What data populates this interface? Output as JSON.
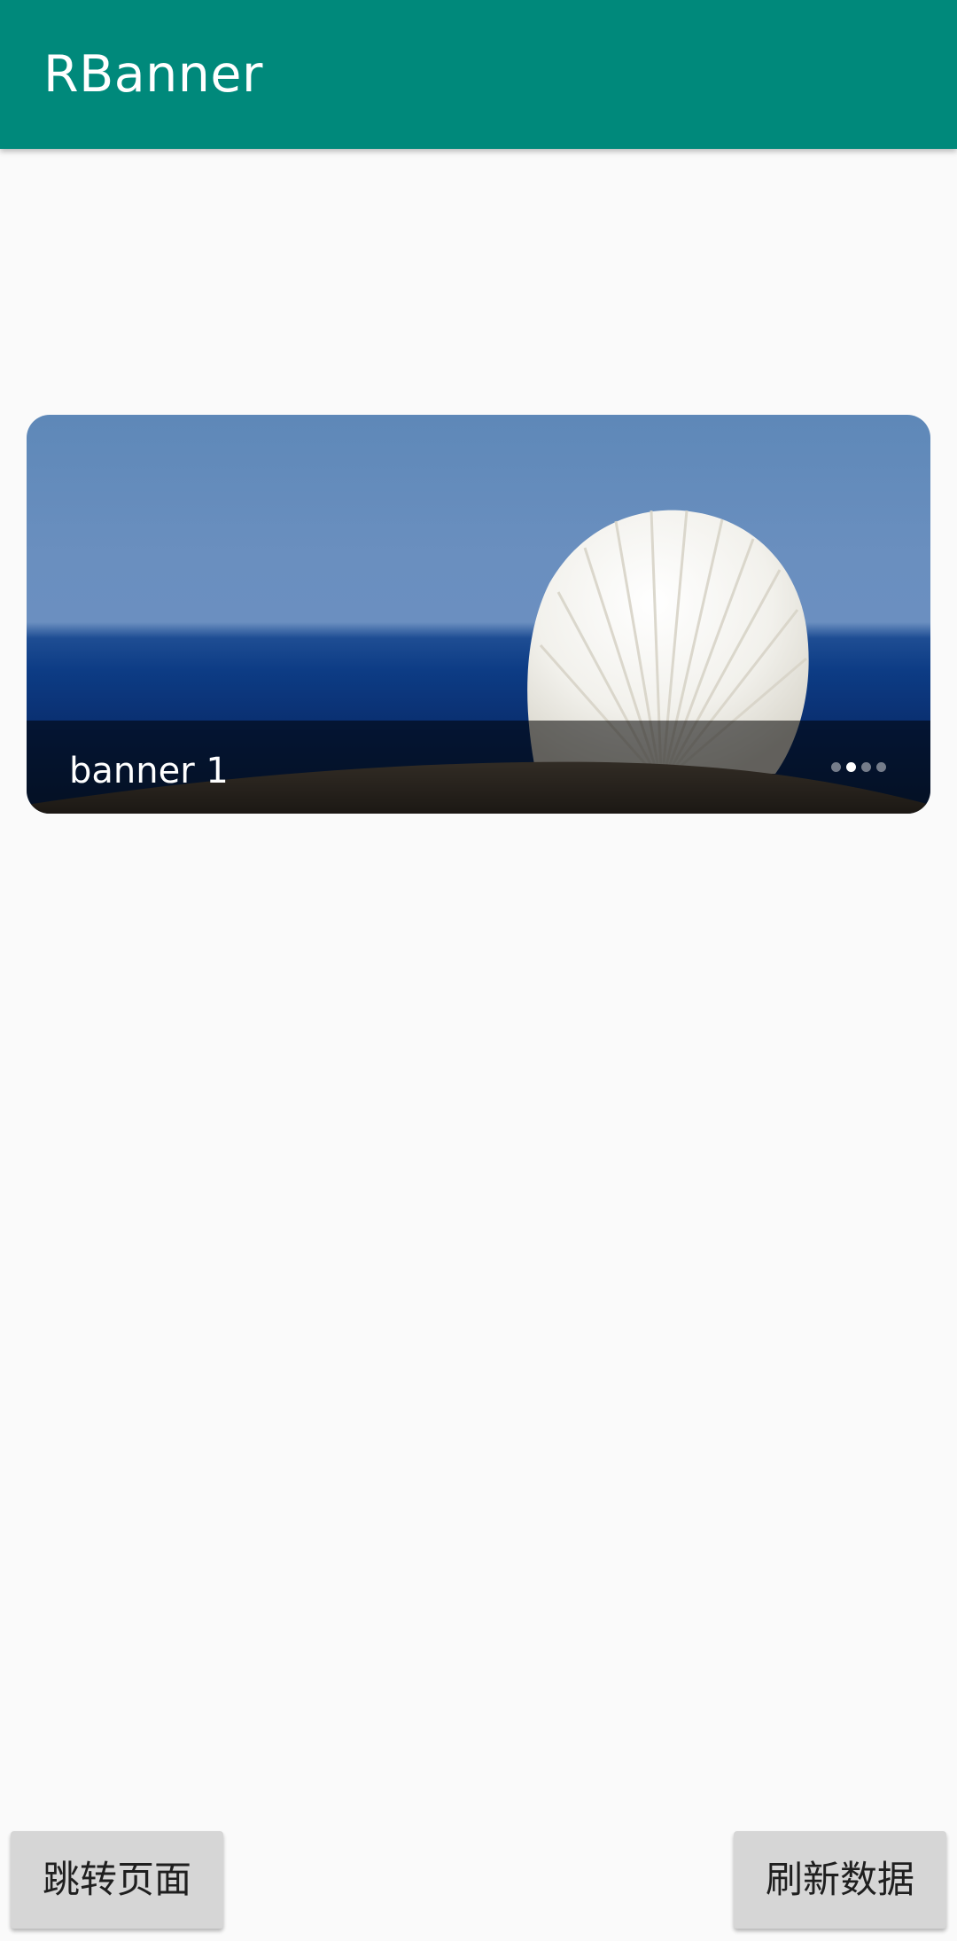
{
  "app_bar": {
    "title": "RBanner",
    "color": "#00897B"
  },
  "banner": {
    "caption": "banner 1",
    "image": "seashell-on-sand-image",
    "indicator": {
      "count": 4,
      "active_index": 1
    }
  },
  "buttons": {
    "left_label": "跳转页面",
    "right_label": "刷新数据"
  }
}
